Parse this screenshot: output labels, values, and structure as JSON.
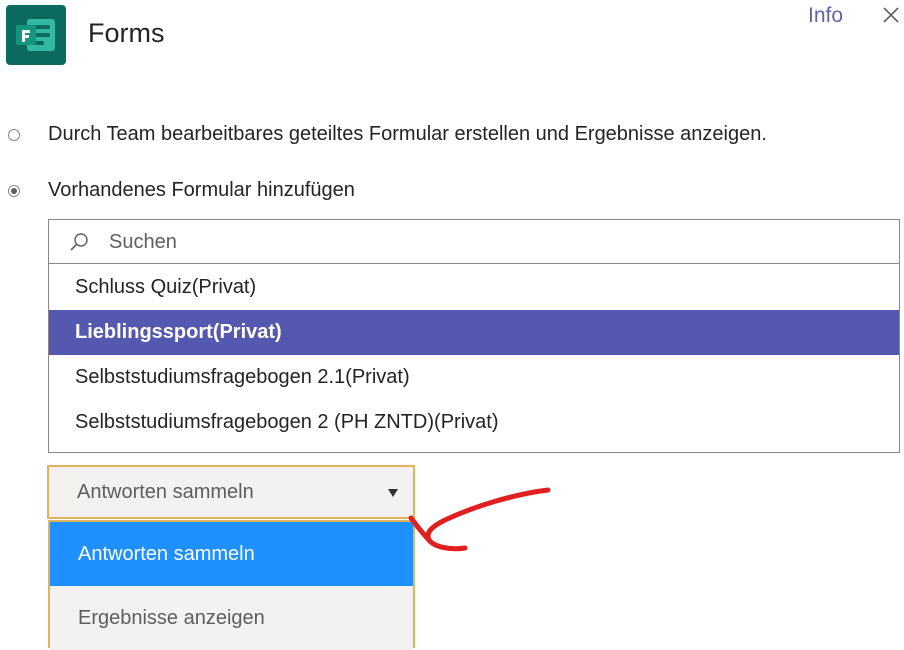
{
  "header": {
    "app_name": "Forms",
    "info_label": "Info",
    "brand_color": "#0b7b6b",
    "icons": {
      "app": "forms-app-icon",
      "close": "close-icon"
    }
  },
  "options": [
    {
      "label": "Durch Team bearbeitbares geteiltes Formular erstellen und Ergebnisse anzeigen.",
      "checked": false
    },
    {
      "label": "Vorhandenes Formular hinzufügen",
      "checked": true
    }
  ],
  "search": {
    "placeholder": "Suchen",
    "value": "",
    "icon": "search-icon"
  },
  "forms": [
    {
      "label": "Schluss Quiz(Privat)",
      "selected": false
    },
    {
      "label": "Lieblingssport(Privat)",
      "selected": true
    },
    {
      "label": "Selbststudiumsfragebogen 2.1(Privat)",
      "selected": false
    },
    {
      "label": "Selbststudiumsfragebogen 2 (PH ZNTD)(Privat)",
      "selected": false
    }
  ],
  "mode_dropdown": {
    "value": "Antworten sammeln",
    "caret_icon": "caret-down-icon",
    "options": [
      {
        "label": "Antworten sammeln",
        "highlighted": true
      },
      {
        "label": "Ergebnisse anzeigen",
        "highlighted": false
      }
    ]
  },
  "colors": {
    "accent": "#5558af",
    "menu_highlight": "#1e90ff",
    "dropdown_border": "#e2b35e",
    "annotation": "#e02020"
  }
}
